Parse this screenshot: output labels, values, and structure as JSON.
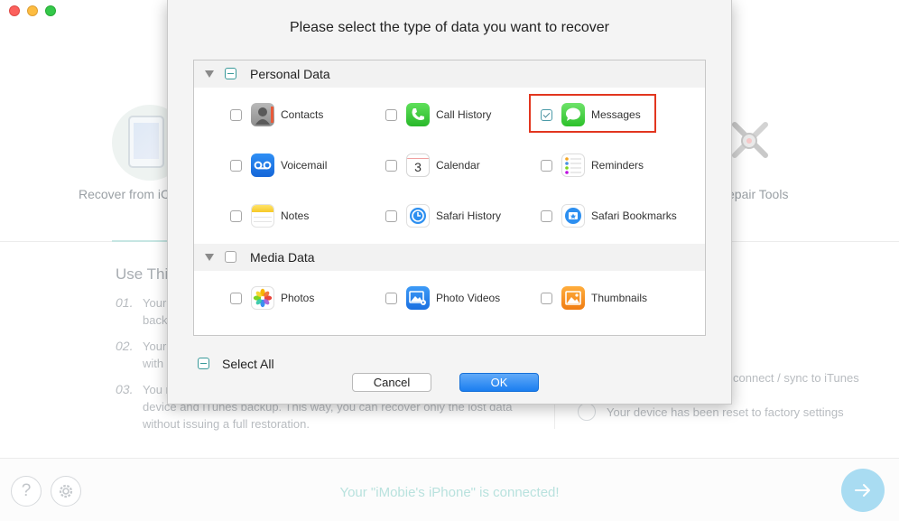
{
  "window": {
    "controls": [
      "close",
      "minimize",
      "maximize"
    ]
  },
  "background": {
    "mode_left_label": "Recover from iC",
    "mode_right_label": "epair Tools",
    "use_title": "Use Thi",
    "steps": [
      {
        "num": "01.",
        "lines": [
          "Your",
          "back"
        ]
      },
      {
        "num": "02.",
        "lines": [
          "Your",
          "with"
        ]
      },
      {
        "num": "03.",
        "lines": [
          "You r",
          "device and iTunes backup. This way, you can recover only the lost data",
          "without issuing a full restoration."
        ]
      }
    ],
    "right_lines": [
      "connect / sync to iTunes",
      "Your device has been reset to factory settings"
    ],
    "status": "Your \"iMobie's iPhone\" is connected!",
    "help_icon": "question-icon",
    "settings_icon": "gear-icon",
    "next_icon": "arrow-right-icon"
  },
  "dialog": {
    "title": "Please select the type of data you want to recover",
    "sections": [
      {
        "label": "Personal Data",
        "state": "mixed",
        "items": [
          {
            "label": "Contacts",
            "icon": "contacts-icon",
            "checked": false
          },
          {
            "label": "Call History",
            "icon": "phone-icon",
            "checked": false
          },
          {
            "label": "Messages",
            "icon": "messages-icon",
            "checked": true
          },
          {
            "label": "Voicemail",
            "icon": "voicemail-icon",
            "checked": false
          },
          {
            "label": "Calendar",
            "icon": "calendar-icon",
            "checked": false,
            "icon_text": "3"
          },
          {
            "label": "Reminders",
            "icon": "reminders-icon",
            "checked": false
          },
          {
            "label": "Notes",
            "icon": "notes-icon",
            "checked": false
          },
          {
            "label": "Safari History",
            "icon": "safari-history-icon",
            "checked": false
          },
          {
            "label": "Safari Bookmarks",
            "icon": "safari-bookmarks-icon",
            "checked": false
          }
        ]
      },
      {
        "label": "Media Data",
        "state": "unchecked",
        "items": [
          {
            "label": "Photos",
            "icon": "photos-icon",
            "checked": false
          },
          {
            "label": "Photo Videos",
            "icon": "photo-videos-icon",
            "checked": false
          },
          {
            "label": "Thumbnails",
            "icon": "thumbnails-icon",
            "checked": false
          }
        ]
      }
    ],
    "select_all": {
      "label": "Select All",
      "state": "mixed"
    },
    "buttons": {
      "cancel": "Cancel",
      "ok": "OK"
    }
  },
  "colors": {
    "highlight_border": "#e2361f",
    "ok_button": "#1a7ef0",
    "status_text": "#b9e2de",
    "next_button": "#a9dcf2"
  }
}
